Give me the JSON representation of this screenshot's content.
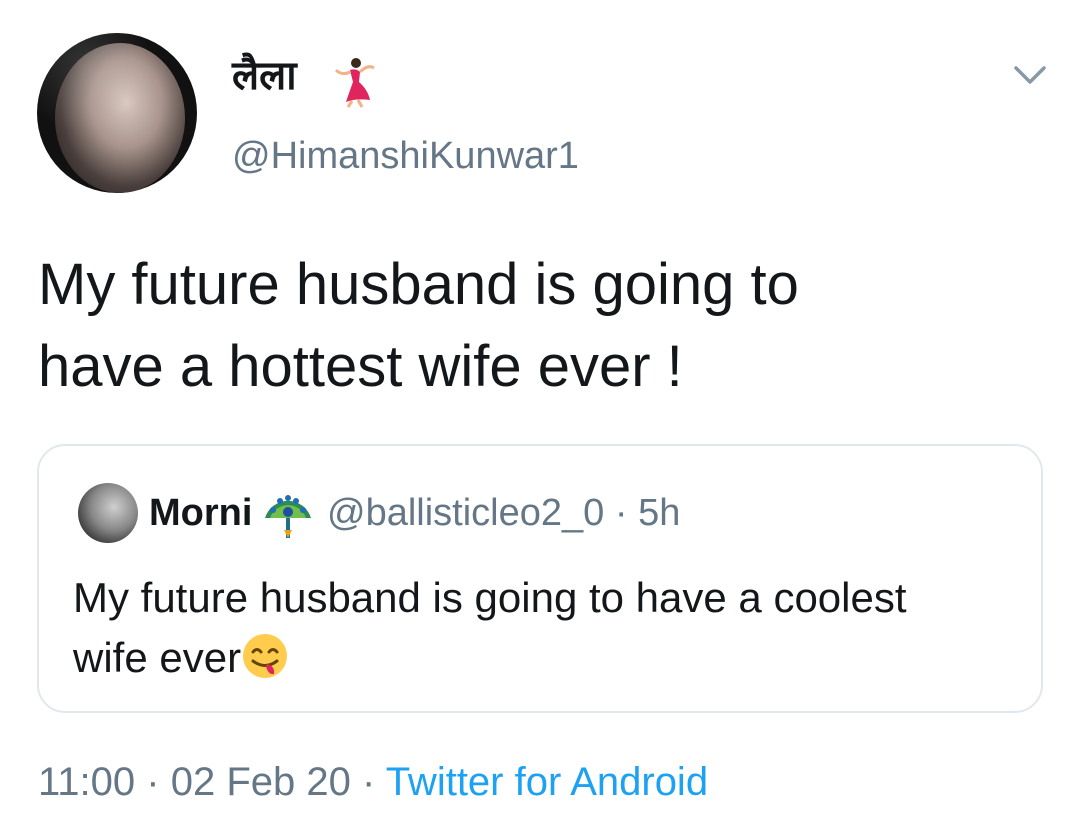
{
  "tweet": {
    "author": {
      "display_name": "लैला",
      "name_emoji": "dancer-emoji",
      "handle": "@HimanshiKunwar1"
    },
    "menu_icon": "chevron-down-icon",
    "text_line1": "My future husband is going to",
    "text_line2": "have a hottest wife ever !",
    "quoted": {
      "display_name": "Morni",
      "name_emoji": "peacock-emoji",
      "handle": "@ballisticleo2_0",
      "separator": "·",
      "time_ago": "5h",
      "text_line1": "My future husband is going to have a coolest",
      "text_line2": "wife ever",
      "trailing_emoji": "yum-face-emoji"
    },
    "footer": {
      "time": "11:00",
      "separator1": "·",
      "date": "02 Feb 20",
      "separator2": "·",
      "source": "Twitter for Android"
    }
  },
  "colors": {
    "primary_text": "#14171a",
    "secondary_text": "#657786",
    "link": "#1da1f2",
    "border": "#e1e8ed"
  }
}
